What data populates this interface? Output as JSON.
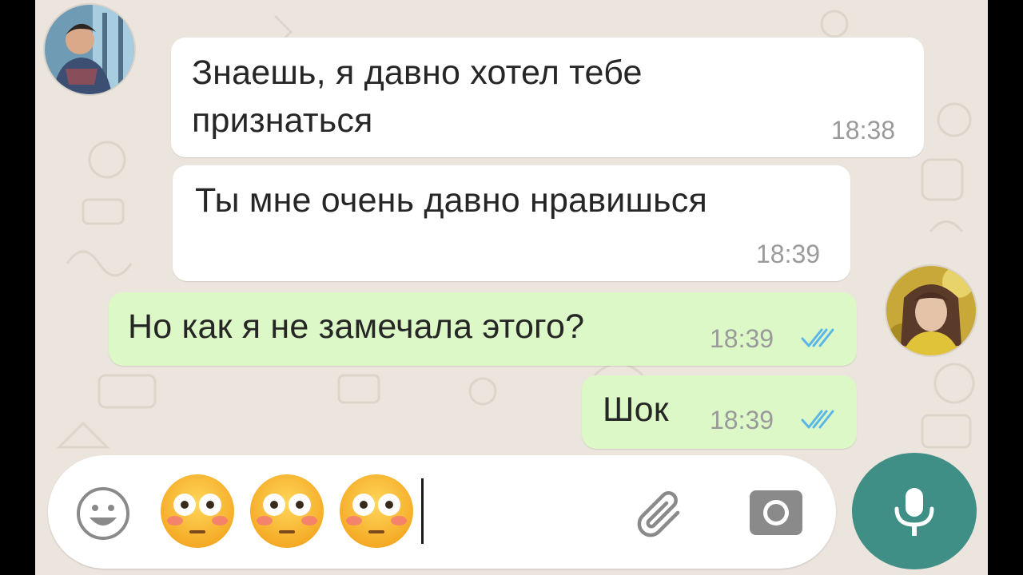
{
  "messages": [
    {
      "direction": "incoming",
      "line1": "Знаешь, я давно хотел тебе",
      "line2": "признаться",
      "time": "18:38"
    },
    {
      "direction": "incoming",
      "line1": "Ты мне очень давно нравишься",
      "time": "18:39"
    },
    {
      "direction": "outgoing",
      "line1": "Но как я не замечала этого?",
      "time": "18:39",
      "status": "read"
    },
    {
      "direction": "outgoing",
      "line1": "Шок",
      "time": "18:39",
      "status": "read"
    }
  ],
  "composer": {
    "typed_emoji": [
      "flushed-face",
      "flushed-face",
      "flushed-face"
    ],
    "icons": [
      "smiley-icon",
      "paperclip-icon",
      "camera-icon",
      "microphone-icon"
    ]
  },
  "colors": {
    "background": "#ece5dd",
    "incoming_bubble": "#ffffff",
    "outgoing_bubble": "#dcf8c6",
    "read_ticks": "#5ab5e8",
    "mic_button": "#3f8f86"
  }
}
